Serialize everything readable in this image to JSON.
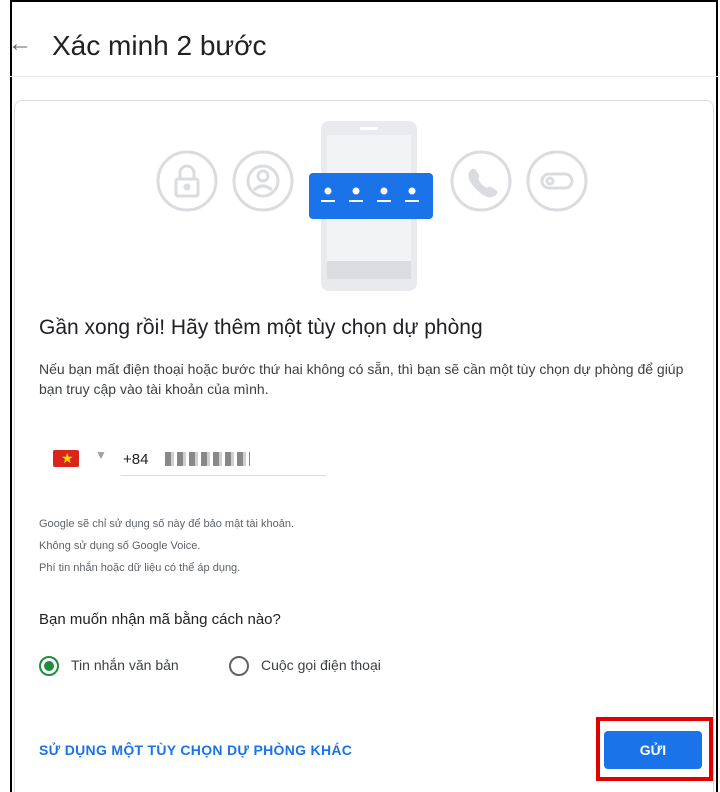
{
  "header": {
    "back_icon": "arrow-left-icon",
    "title": "Xác minh 2 bước"
  },
  "card": {
    "heading": "Gần xong rồi! Hãy thêm một tùy chọn dự phòng",
    "description": "Nếu bạn mất điện thoại hoặc bước thứ hai không có sẵn, thì bạn sẽ cần một tùy chọn dự phòng để giúp bạn truy cập vào tài khoản của mình.",
    "phone": {
      "country_flag": "vietnam-flag-icon",
      "prefix": "+84"
    },
    "notes": [
      "Google sẽ chỉ sử dụng số này để bảo mật tài khoản.",
      "Không sử dụng số Google Voice.",
      "Phí tin nhắn hoặc dữ liệu có thể áp dụng."
    ],
    "method_question": "Bạn muốn nhận mã bằng cách nào?",
    "methods": [
      {
        "label": "Tin nhắn văn bản",
        "checked": true
      },
      {
        "label": "Cuộc gọi điện thoại",
        "checked": false
      }
    ],
    "alt_option_link": "SỬ DỤNG MỘT TÙY CHỌN DỰ PHÒNG KHÁC",
    "send_button": "GỬI"
  },
  "colors": {
    "accent": "#1a73e8",
    "radio_checked": "#1e8e3e",
    "highlight": "#e00000"
  }
}
